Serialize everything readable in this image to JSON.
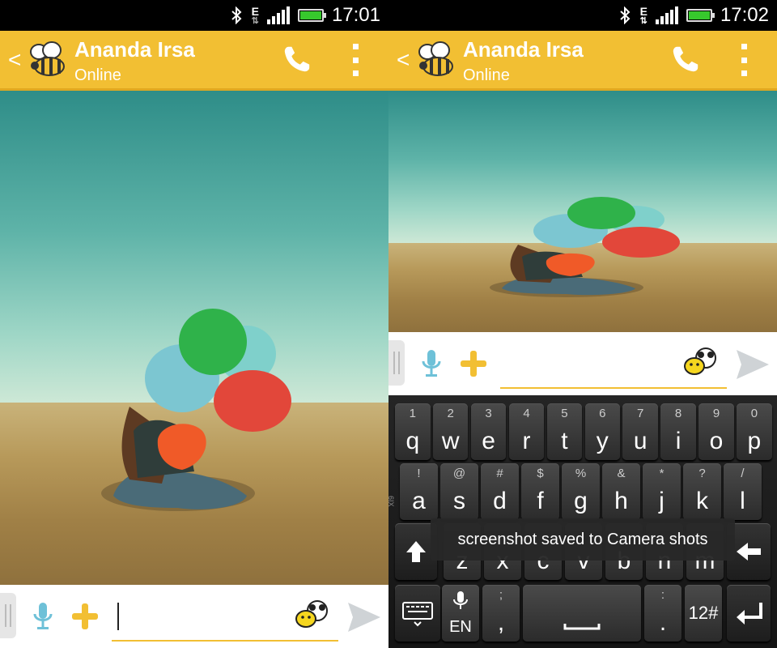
{
  "left": {
    "status": {
      "time": "17:01",
      "network": "E"
    },
    "header": {
      "name": "Ananda Irsa",
      "status": "Online"
    },
    "input": {
      "placeholder": ""
    }
  },
  "right": {
    "status": {
      "time": "17:02",
      "network": "E"
    },
    "header": {
      "name": "Ananda Irsa",
      "status": "Online"
    },
    "input": {
      "placeholder": ""
    },
    "keyboard": {
      "row1": [
        {
          "hint": "1",
          "main": "q"
        },
        {
          "hint": "2",
          "main": "w"
        },
        {
          "hint": "3",
          "main": "e"
        },
        {
          "hint": "4",
          "main": "r"
        },
        {
          "hint": "5",
          "main": "t"
        },
        {
          "hint": "6",
          "main": "y"
        },
        {
          "hint": "7",
          "main": "u"
        },
        {
          "hint": "8",
          "main": "i"
        },
        {
          "hint": "9",
          "main": "o"
        },
        {
          "hint": "0",
          "main": "p"
        }
      ],
      "row2": [
        {
          "hint": "!",
          "main": "a"
        },
        {
          "hint": "@",
          "main": "s"
        },
        {
          "hint": "#",
          "main": "d"
        },
        {
          "hint": "$",
          "main": "f"
        },
        {
          "hint": "%",
          "main": "g"
        },
        {
          "hint": "&",
          "main": "h"
        },
        {
          "hint": "*",
          "main": "j"
        },
        {
          "hint": "?",
          "main": "k"
        },
        {
          "hint": "/",
          "main": "l"
        }
      ],
      "row3": [
        {
          "hint": "",
          "main": "z"
        },
        {
          "hint": "",
          "main": "x"
        },
        {
          "hint": "",
          "main": "c"
        },
        {
          "hint": "",
          "main": "v"
        },
        {
          "hint": "",
          "main": "b"
        },
        {
          "hint": "",
          "main": "n"
        },
        {
          "hint": "",
          "main": "m"
        }
      ],
      "lang": "EN",
      "comma_hint": ";",
      "comma": ",",
      "period_hint": ":",
      "period": ".",
      "symbols": "12#",
      "side_label": "6IX"
    },
    "toast": "screenshot saved to Camera shots"
  },
  "colors": {
    "brand": "#f2bf33",
    "accent_mic": "#6ec1d8",
    "send": "#cfd3d6"
  }
}
